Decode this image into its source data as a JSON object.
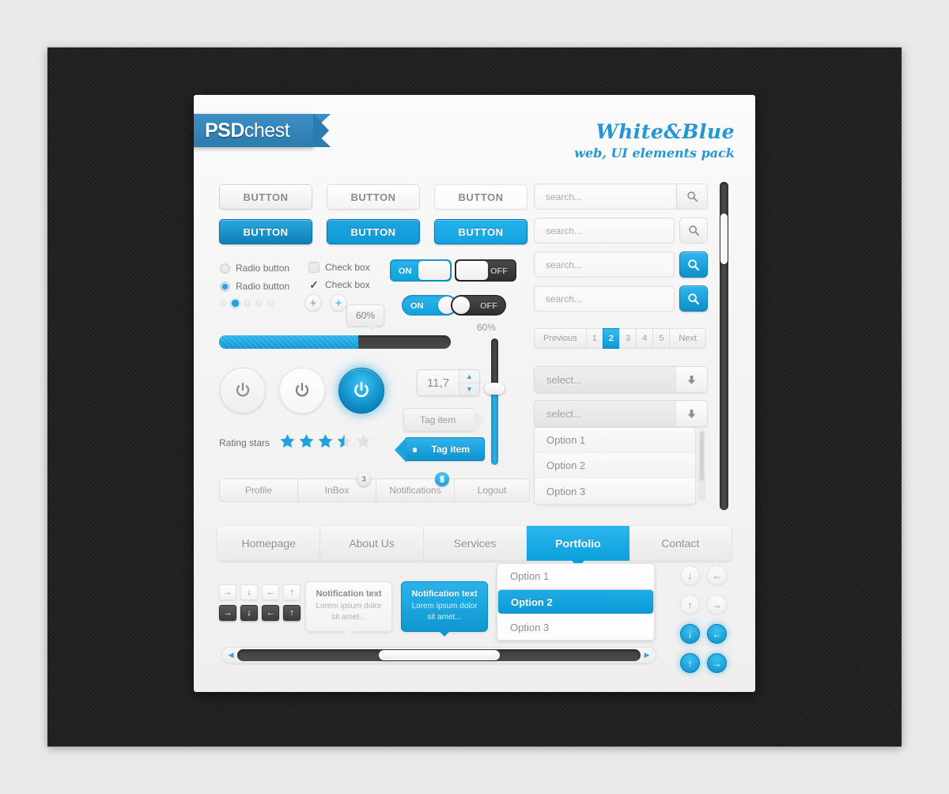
{
  "brand": {
    "logo_strong": "PSD",
    "logo_light": "chest"
  },
  "kit": {
    "title": "White&Blue",
    "subtitle": "web, UI elements pack"
  },
  "buttons": {
    "grey": [
      "BUTTON",
      "BUTTON",
      "BUTTON"
    ],
    "blue": [
      "BUTTON",
      "BUTTON",
      "BUTTON"
    ]
  },
  "radios": [
    {
      "label": "Radio button",
      "checked": false
    },
    {
      "label": "Radio button",
      "checked": true
    }
  ],
  "checkboxes": [
    {
      "label": "Check box",
      "checked": false
    },
    {
      "label": "Check box",
      "checked": true,
      "mark": "✓"
    }
  ],
  "switches": {
    "square_on": "ON",
    "square_off": "OFF",
    "pill_on": "ON",
    "pill_off": "OFF"
  },
  "plus_buttons": {
    "grey": "+",
    "blue": "+"
  },
  "progress": {
    "tooltip": "60%",
    "percent": 60
  },
  "vertical_slider": {
    "label": "60%",
    "percent": 60
  },
  "rating": {
    "label": "Rating stars",
    "value": 3.5,
    "max": 5
  },
  "spinner": {
    "value": "11,7",
    "up": "▲",
    "down": "▼"
  },
  "tags": {
    "grey": "Tag item",
    "blue": "Tag item"
  },
  "account_tabs": [
    {
      "label": "Profile",
      "badge": null
    },
    {
      "label": "InBox",
      "badge": "3",
      "badge_style": "grey"
    },
    {
      "label": "Notifications",
      "badge": "5",
      "badge_style": "blue"
    },
    {
      "label": "Logout",
      "badge": null
    }
  ],
  "search_fields": [
    {
      "placeholder": "search...",
      "button": "search-icon",
      "style": "grey-attached"
    },
    {
      "placeholder": "search...",
      "button": "search-icon",
      "style": "grey-detached"
    },
    {
      "placeholder": "search...",
      "button": "search-icon",
      "style": "blue"
    },
    {
      "placeholder": "search...",
      "button": "search-icon",
      "style": "blue"
    }
  ],
  "pagination": {
    "previous": "Previous",
    "pages": [
      "1",
      "2",
      "3",
      "4",
      "5"
    ],
    "active": "2",
    "next": "Next"
  },
  "selects": [
    {
      "value": "select..."
    },
    {
      "value": "select..."
    }
  ],
  "select_options": [
    "Option 1",
    "Option 2",
    "Option 3"
  ],
  "navbar": [
    {
      "label": "Homepage",
      "active": false
    },
    {
      "label": "About Us",
      "active": false
    },
    {
      "label": "Services",
      "active": false
    },
    {
      "label": "Portfolio",
      "active": true
    },
    {
      "label": "Contact",
      "active": false
    }
  ],
  "arrow_buttons": {
    "light": [
      "→",
      "↓",
      "←",
      "↑"
    ],
    "dark": [
      "→",
      "↓",
      "←",
      "↑"
    ]
  },
  "notifications": [
    {
      "title": "Notification text",
      "body": "Lorem ipsum dolor sit amet...",
      "style": "grey"
    },
    {
      "title": "Notification text",
      "body": "Lorem ipsum dolor sit amet...",
      "style": "blue"
    }
  ],
  "dropdown_menu": {
    "items": [
      "Option 1",
      "Option 2",
      "Option 3"
    ],
    "selected": "Option 2"
  },
  "circle_arrows": {
    "grey": [
      "↓",
      "←",
      "↑",
      "→"
    ],
    "blue": [
      "↓",
      "←",
      "↑",
      "→"
    ]
  },
  "colors": {
    "accent_blue": "#1fa3e0",
    "blue_dark": "#0d85bb",
    "panel_bg": "#f4f4f4",
    "backdrop": "#232323",
    "page_bg": "#e9e9e9",
    "text_grey": "#8e8e8e",
    "track_dark": "#3d3d3d"
  }
}
